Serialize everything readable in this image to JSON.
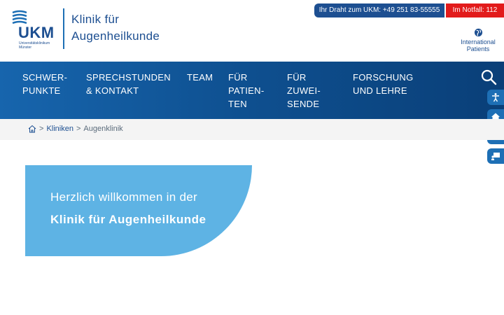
{
  "header": {
    "logo_text": "UKM",
    "logo_sub": "Universitätsklinikum Münster",
    "clinic_line1": "Klinik für",
    "clinic_line2": "Augenheilkunde",
    "hotline": "Ihr Draht zum UKM: +49 251 83-55555",
    "emergency": "Im Notfall: 112",
    "intl_line1": "International",
    "intl_line2": "Patients",
    "colors": {
      "brand": "#1d4f91",
      "emergency": "#e21b1b"
    }
  },
  "nav": {
    "items": [
      {
        "line1": "SCHWER-",
        "line2": "PUNKTE",
        "line3": ""
      },
      {
        "line1": "SPRECHSTUNDEN",
        "line2": "& KONTAKT",
        "line3": ""
      },
      {
        "line1": "TEAM",
        "line2": "",
        "line3": ""
      },
      {
        "line1": "FÜR",
        "line2": "PATIEN-",
        "line3": "TEN"
      },
      {
        "line1": "FÜR",
        "line2": "ZUWEI-",
        "line3": "SENDE"
      },
      {
        "line1": "FORSCHUNG",
        "line2": "UND LEHRE",
        "line3": ""
      }
    ],
    "search_icon": "search-icon",
    "sidebar_icons": [
      "accessibility-icon",
      "home-icon",
      "hospital-icon",
      "presentation-icon"
    ]
  },
  "breadcrumb": {
    "sep1": ">",
    "kliniken": "Kliniken",
    "sep2": ">",
    "current": "Augenklinik"
  },
  "hero": {
    "line1": "Herzlich willkommen in der",
    "line2": "Klinik für Augenheilkunde",
    "color": "#5eb3e4"
  }
}
